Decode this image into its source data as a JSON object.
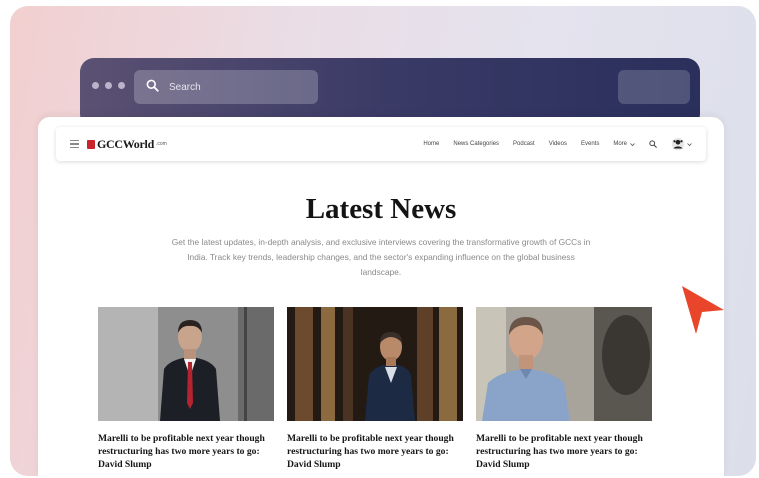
{
  "browser_chrome": {
    "search_placeholder": "Search",
    "search_icon": "search-icon"
  },
  "site": {
    "logo_text": "GCCWorld",
    "logo_suffix": ".com",
    "logo_color": "#c8242b"
  },
  "nav": {
    "items": [
      {
        "label": "Home"
      },
      {
        "label": "News Categories"
      },
      {
        "label": "Podcast"
      },
      {
        "label": "Videos"
      },
      {
        "label": "Events"
      }
    ],
    "more_label": "More",
    "search_icon": "search-icon",
    "avatar_icon": "user-avatar-icon"
  },
  "hero": {
    "title": "Latest News",
    "description": "Get the latest updates, in-depth analysis, and exclusive interviews covering the transformative growth of GCCs in India. Track key trends, leadership changes, and the sector's expanding influence on the global business landscape."
  },
  "articles": [
    {
      "title": "Marelli to be profitable next year though restructuring has two more years to go: David Slump"
    },
    {
      "title": "Marelli to be profitable next year though restructuring has two more years to go: David Slump"
    },
    {
      "title": "Marelli to be profitable next year though restructuring has two more years to go: David Slump"
    }
  ],
  "colors": {
    "accent_arrow": "#e8452a",
    "chrome_bar": "#2f3360"
  }
}
